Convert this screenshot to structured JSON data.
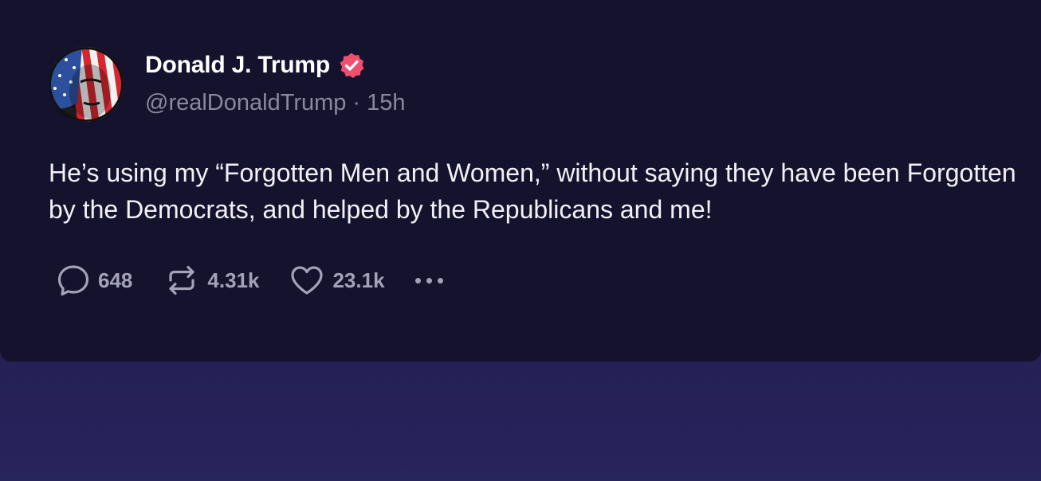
{
  "post": {
    "author_name": "Donald J. Trump",
    "handle": "@realDonaldTrump",
    "separator": "·",
    "time_ago": "15h",
    "text": "He’s using my “Forgotten Men and Women,” without saying they have been Forgotten by the Democrats, and helped by the Republicans and me!",
    "verified": true
  },
  "actions": {
    "replies": "648",
    "reposts": "4.31k",
    "likes": "23.1k"
  },
  "icons": {
    "reply": "speech-bubble-icon",
    "repost": "repost-arrows-icon",
    "like": "heart-icon",
    "more": "more-dots-icon",
    "verified": "verified-badge-icon"
  },
  "colors": {
    "background": "#15122e",
    "accent_verified": "#ef4f6f",
    "muted_text": "#8a879e"
  }
}
